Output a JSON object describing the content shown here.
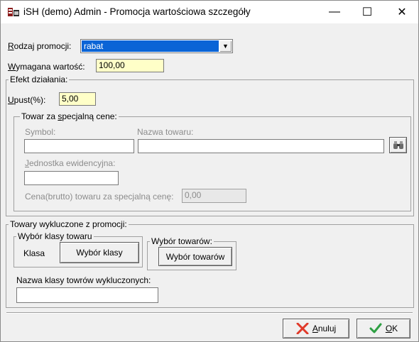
{
  "window": {
    "title": "iSH (demo) Admin - Promocja wartościowa szczegóły",
    "minimize": "—",
    "maximize": "☐",
    "close": "✕"
  },
  "promo": {
    "type_label_u": "R",
    "type_label_rest": "odzaj promocji:",
    "type_value": "rabat",
    "amount_label_u": "W",
    "amount_label_rest": "ymagana wartość:",
    "amount_value": "100,00"
  },
  "effect": {
    "group_label": "Efekt działania:",
    "discount_label_u": "U",
    "discount_label_rest": "pust(%):",
    "discount_value": "5,00",
    "special": {
      "group_label_pre": "Towar za ",
      "group_label_u": "s",
      "group_label_post": "pecjalną cene:",
      "symbol_label": "Symbol:",
      "name_label": "Nazwa towaru:",
      "symbol_value": "",
      "name_value": "",
      "unit_label_u": "J",
      "unit_label_rest": "ednostka ewidencyjna:",
      "unit_value": "",
      "price_label": "Cena(brutto) towaru za specjalną cenę:",
      "price_value": "0,00"
    }
  },
  "excluded": {
    "group_label": "Towary wykluczone z promocji:",
    "class_group_label": "Wybór klasy towaru",
    "class_label": "Klasa",
    "class_button": "Wybór klasy",
    "goods_group_label": "Wybór towarów:",
    "goods_button": "Wybór towarów",
    "class_names_label": "Nazwa klasy towrów wykluczonych:",
    "class_names_value": ""
  },
  "footer": {
    "cancel_u": "A",
    "cancel_rest": "nuluj",
    "ok_u": "O",
    "ok_rest": "K"
  },
  "colors": {
    "accent": "#0a64d6",
    "input_highlight": "#ffffc8",
    "cancel_icon": "#e03a2a",
    "ok_icon": "#2ea043"
  }
}
